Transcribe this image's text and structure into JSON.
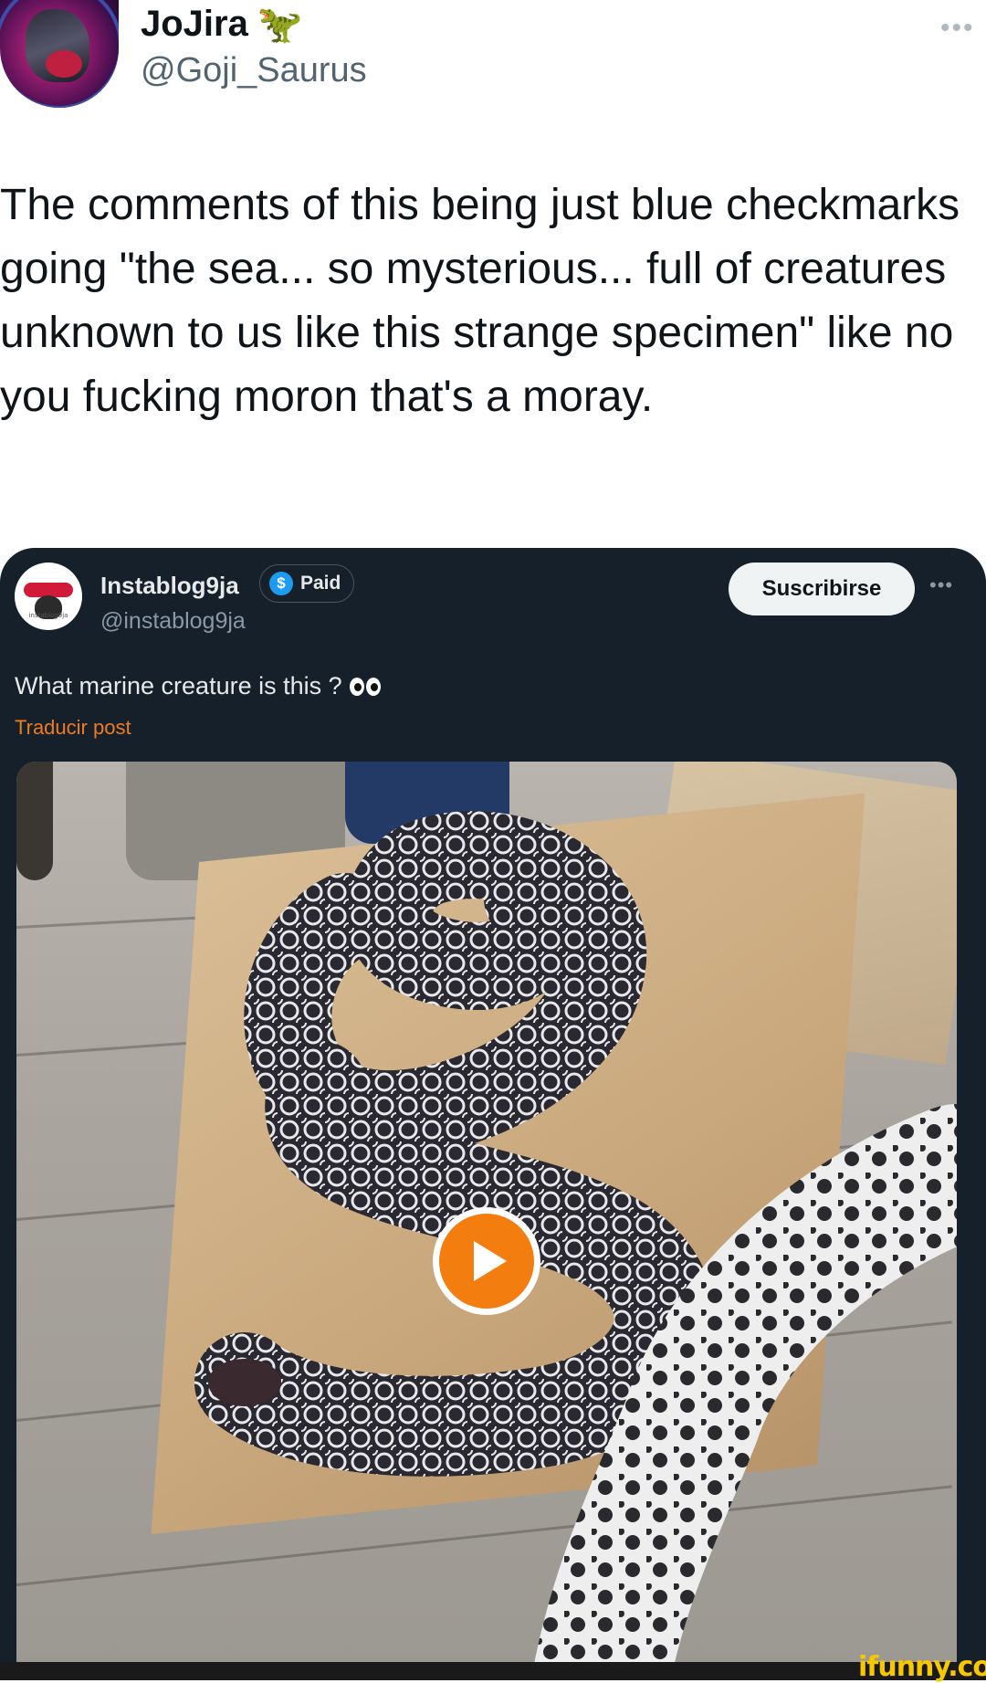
{
  "author": {
    "display_name": "JoJira",
    "emoji_icon": "dinosaur-icon",
    "handle": "@Goji_Saurus"
  },
  "post": {
    "text": "The comments of this being just blue checkmarks going \"the sea... so mysterious... full of creatures unknown to us like this strange specimen\" like no you fucking moron that's a moray."
  },
  "quoted": {
    "display_name": "Instablog9ja",
    "paid_label": "Paid",
    "handle": "@instablog9ja",
    "subscribe_label": "Suscribirse",
    "text": "What marine creature is this ?",
    "translate_label": "Traducir post",
    "avatar_tag": "instablog9ja"
  },
  "watermark": "ifunny.co",
  "colors": {
    "card_bg": "#15202b",
    "accent_orange": "#f47d10",
    "translate_link": "#f07b1e",
    "verified_blue": "#1d9bf0",
    "watermark_yellow": "#f7c800"
  }
}
